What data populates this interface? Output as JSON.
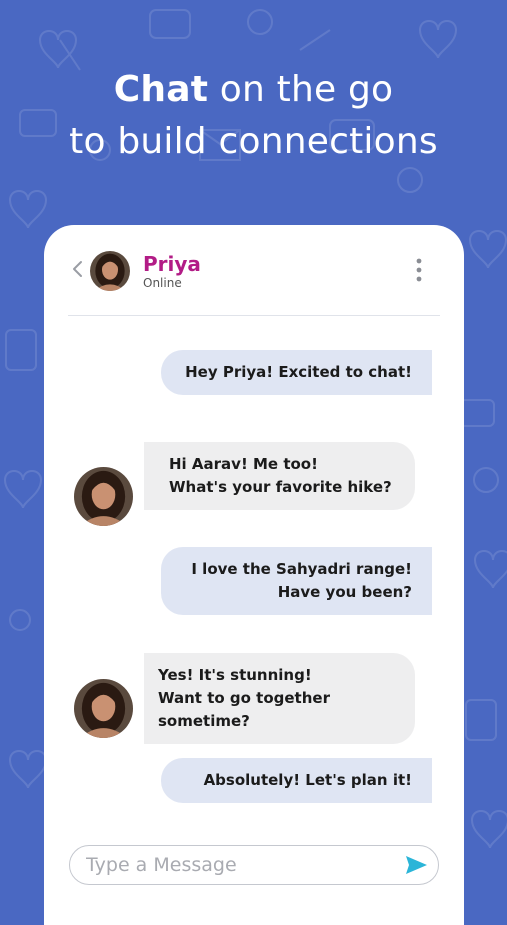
{
  "headline": {
    "line1_bold": "Chat",
    "line1_rest": " on the go",
    "line2": "to build connections"
  },
  "chat_header": {
    "back_icon": "chevron-left-icon",
    "contact_name": "Priya",
    "status": "Online",
    "menu_icon": "more-vertical-icon"
  },
  "messages": [
    {
      "from": "me",
      "lines": [
        "Hey Priya! Excited to chat!"
      ]
    },
    {
      "from": "Priya",
      "lines": [
        "Hi Aarav! Me too!",
        "What's your favorite hike?"
      ]
    },
    {
      "from": "me",
      "lines": [
        "I love the Sahyadri range!",
        "Have you been?"
      ]
    },
    {
      "from": "Priya",
      "lines": [
        "Yes! It's stunning!",
        "Want to go together sometime?"
      ]
    },
    {
      "from": "me",
      "lines": [
        "Absolutely! Let's plan it!"
      ]
    }
  ],
  "composer": {
    "placeholder": "Type a Message",
    "value": "",
    "send_icon": "send-icon"
  },
  "colors": {
    "background": "#4a68c2",
    "contact_name": "#b21c86",
    "sent_bubble": "#dfe5f3",
    "received_bubble": "#eeeeef",
    "send_icon": "#2bb5d8"
  }
}
